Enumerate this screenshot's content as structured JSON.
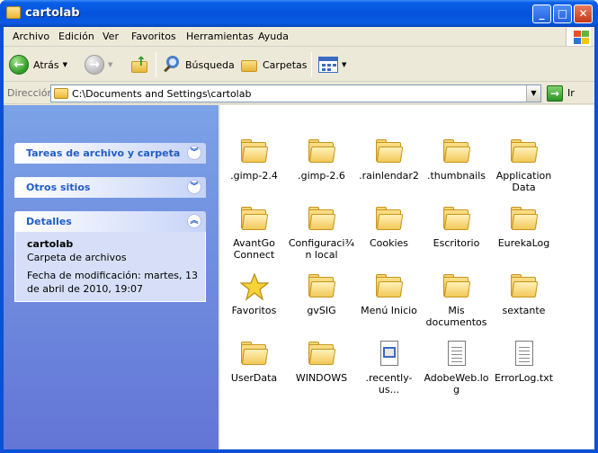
{
  "window": {
    "title": "cartolab"
  },
  "menu": [
    "Archivo",
    "Edición",
    "Ver",
    "Favoritos",
    "Herramientas",
    "Ayuda"
  ],
  "toolbar": {
    "back_label": "Atrás",
    "search_label": "Búsqueda",
    "folders_label": "Carpetas"
  },
  "address": {
    "label": "Dirección",
    "path": "C:\\Documents and Settings\\cartolab",
    "go_label": "Ir"
  },
  "sidebar": {
    "tasks_title": "Tareas de archivo y carpeta",
    "other_title": "Otros sitios",
    "details_title": "Detalles",
    "details_name": "cartolab",
    "details_type": "Carpeta de archivos",
    "details_modified": "Fecha de modificación: martes, 13 de abril de 2010, 19:07"
  },
  "items": [
    {
      "label": ".gimp-2.4",
      "icon": "folder-icon"
    },
    {
      "label": ".gimp-2.6",
      "icon": "folder-icon"
    },
    {
      "label": ".rainlendar2",
      "icon": "folder-icon"
    },
    {
      "label": ".thumbnails",
      "icon": "folder-icon"
    },
    {
      "label": "Application Data",
      "icon": "folder-icon"
    },
    {
      "label": "AvantGo Connect",
      "icon": "folder-icon"
    },
    {
      "label": "Configuraci¾n local",
      "icon": "folder-icon"
    },
    {
      "label": "Cookies",
      "icon": "folder-icon"
    },
    {
      "label": "Escritorio",
      "icon": "folder-icon"
    },
    {
      "label": "EurekaLog",
      "icon": "folder-icon"
    },
    {
      "label": "Favoritos",
      "icon": "star-icon"
    },
    {
      "label": "gvSIG",
      "icon": "folder-icon"
    },
    {
      "label": "Menú Inicio",
      "icon": "folder-icon"
    },
    {
      "label": "Mis documentos",
      "icon": "folder-icon"
    },
    {
      "label": "sextante",
      "icon": "folder-icon"
    },
    {
      "label": "UserData",
      "icon": "folder-icon"
    },
    {
      "label": "WINDOWS",
      "icon": "folder-icon"
    },
    {
      "label": ".recently-us...",
      "icon": "file-icon"
    },
    {
      "label": "AdobeWeb.log",
      "icon": "text-file-icon"
    },
    {
      "label": "ErrorLog.txt",
      "icon": "text-file-icon"
    }
  ]
}
